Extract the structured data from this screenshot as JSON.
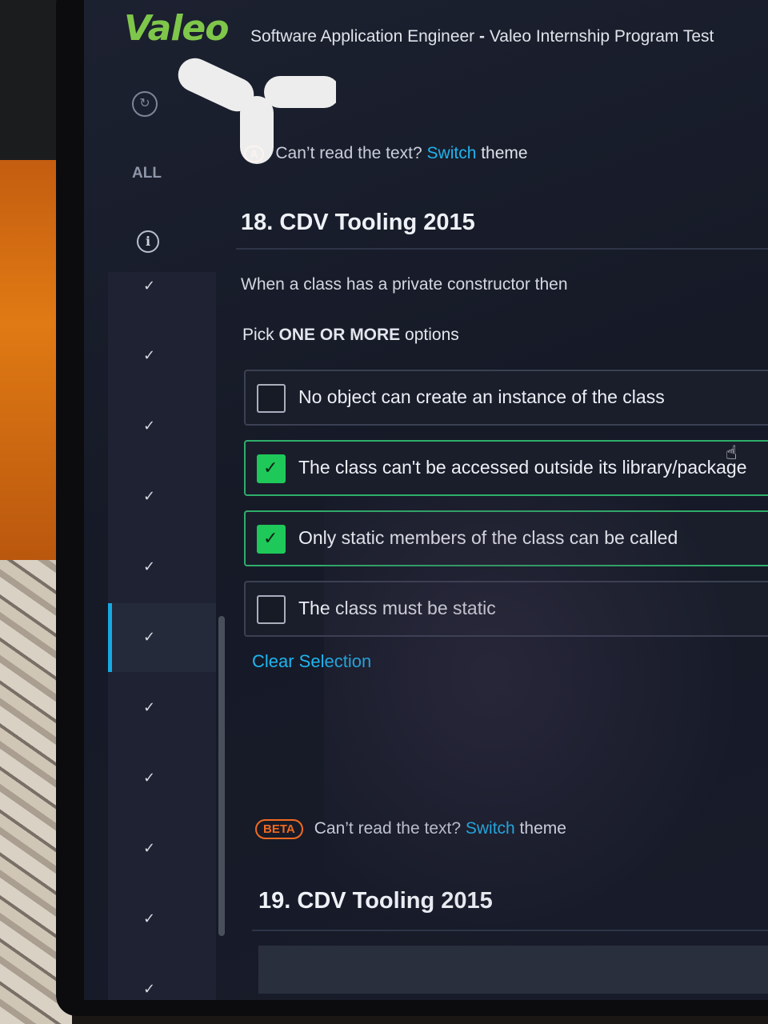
{
  "brand": {
    "logo_text": "Valeo",
    "logo_color": "#7fc74a"
  },
  "header": {
    "title_part1": "Software Application Engineer",
    "separator": " - ",
    "title_part2": "Valeo Internship Program Test"
  },
  "sidebar": {
    "refresh_icon": "refresh-icon",
    "all_label": "ALL",
    "info_icon": "info-icon",
    "info_glyph": "i",
    "check_glyph": "✓",
    "current_index": 5,
    "accent_color": "#17a9e0"
  },
  "theme_notice_1": {
    "badge": "A",
    "prefix": "Can’t read the text? ",
    "link": "Switch",
    "suffix": " theme"
  },
  "question_18": {
    "title": "18. CDV Tooling 2015",
    "text": "When a class has a private constructor then",
    "pick_prefix": "Pick ",
    "pick_emphasis": "ONE OR MORE",
    "pick_suffix": " options",
    "options": [
      {
        "label": "No object can create an instance of the class",
        "selected": false
      },
      {
        "label": "The class can't be accessed outside its library/package",
        "selected": true
      },
      {
        "label": "Only static members of the class can be called",
        "selected": true
      },
      {
        "label": "The class must be static",
        "selected": false
      }
    ],
    "clear_selection": "Clear Selection"
  },
  "theme_notice_2": {
    "badge": "BETA",
    "prefix": "Can’t read the text? ",
    "link": "Switch",
    "suffix": " theme"
  },
  "question_19": {
    "title": "19. CDV Tooling 2015"
  },
  "colors": {
    "selected_checkbox": "#1ec95a",
    "link": "#1fb5f0",
    "beta_badge": "#f06a22"
  }
}
